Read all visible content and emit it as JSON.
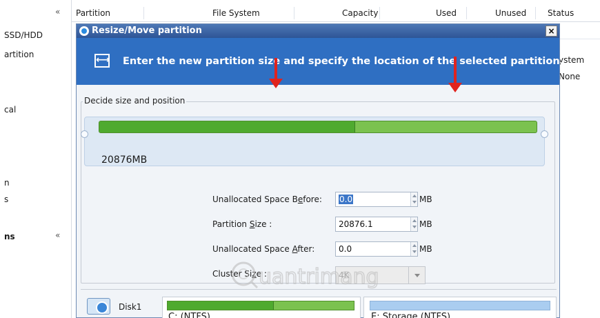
{
  "background": {
    "left_panel": {
      "items": [
        "SSD/HDD",
        "artition",
        "cal",
        "n",
        "s"
      ],
      "section_label": "ns",
      "collapse_glyph": "«"
    },
    "columns": [
      "Partition",
      "File System",
      "Capacity",
      "Used",
      "Unused",
      "Status"
    ],
    "right_cells": [
      "ystem",
      "None"
    ]
  },
  "dialog": {
    "title": "Resize/Move partition",
    "close_label": "×",
    "banner_text": "Enter the new partition size and specify the location of the selected partition.",
    "group_label": "Decide size and position",
    "partition_size_display": "20876MB",
    "used_fraction": 0.585,
    "fields": {
      "before": {
        "label_pre": "Unallocated Space B",
        "label_ul": "e",
        "label_post": "fore:",
        "value": "0.0",
        "unit": "MB"
      },
      "size": {
        "label_pre": "Partition ",
        "label_ul": "S",
        "label_post": "ize :",
        "value": "20876.1",
        "unit": "MB"
      },
      "after": {
        "label_pre": "Unallocated Space ",
        "label_ul": "A",
        "label_post": "fter:",
        "value": "0.0",
        "unit": "MB"
      },
      "cluster": {
        "label_pre": "Cluster Si",
        "label_ul": "z",
        "label_post": "e :",
        "value": "4K"
      }
    },
    "watermark_text": "uantrimang",
    "disk_map": {
      "disk_label": "Disk1",
      "partitions": [
        {
          "label": "C: (NTFS)",
          "used_fraction": 0.57
        },
        {
          "label": "E: Storage (NTFS)"
        }
      ]
    }
  },
  "colors": {
    "title_bar": "#2e5596",
    "banner": "#2f6fc2",
    "used_green": "#4faa2f",
    "free_green": "#7bc24f",
    "arrow_red": "#e0231e"
  },
  "icons": [
    "chevron-up-icon",
    "app-icon",
    "close-icon",
    "resize-icon",
    "spin-icon",
    "dropdown-arrow-icon",
    "disk-icon",
    "red-arrow-icon",
    "watermark-logo"
  ]
}
